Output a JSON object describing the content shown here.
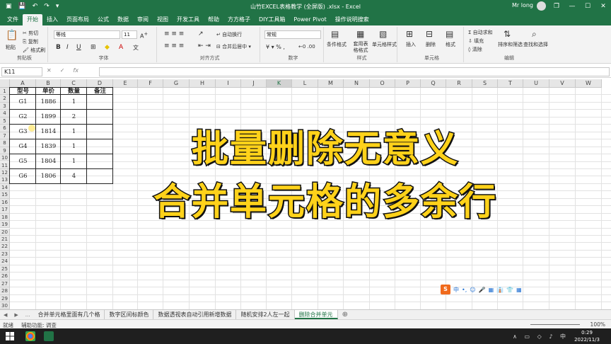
{
  "window": {
    "title": "山竹EXCEL表格教学 (全屏版) .xlsx - Excel",
    "user": "Mr long",
    "min": "—",
    "max": "☐",
    "close": "✕",
    "restore": "❐"
  },
  "ribbon_tabs": [
    "文件",
    "开始",
    "插入",
    "页面布局",
    "公式",
    "数据",
    "审阅",
    "视图",
    "开发工具",
    "帮助",
    "方方格子",
    "DIY工具箱",
    "Power Pivot",
    "操作说明搜索"
  ],
  "active_tab": "开始",
  "ribbon": {
    "clipboard": {
      "paste": "粘贴",
      "cut": "剪切",
      "copy": "复制",
      "painter": "格式刷",
      "label": "剪贴板"
    },
    "font": {
      "name": "等线",
      "size": "11",
      "bold": "B",
      "italic": "I",
      "underline": "U",
      "label": "字体"
    },
    "align": {
      "wrap": "自动换行",
      "merge": "合并后居中",
      "label": "对齐方式"
    },
    "number": {
      "format": "常规",
      "label": "数字"
    },
    "styles": {
      "cond": "条件格式",
      "table": "套用表格格式",
      "cell": "单元格样式",
      "label": "样式"
    },
    "cells": {
      "insert": "插入",
      "delete": "删除",
      "format": "格式",
      "label": "单元格"
    },
    "editing": {
      "autosum": "自动求和",
      "fill": "填充",
      "clear": "清除",
      "sort": "排序和筛选",
      "find": "查找和选择",
      "label": "编辑"
    }
  },
  "formula_bar": {
    "name_box": "K11",
    "fx": "fx",
    "value": ""
  },
  "columns": [
    "A",
    "B",
    "C",
    "D",
    "E",
    "F",
    "G",
    "H",
    "I",
    "J",
    "K",
    "L",
    "M",
    "N",
    "O",
    "P",
    "Q",
    "R",
    "S",
    "T",
    "U",
    "V",
    "W"
  ],
  "selected_column": "K",
  "rows": [
    "1",
    "2",
    "3",
    "4",
    "5",
    "6",
    "7",
    "8",
    "9",
    "10",
    "11",
    "12",
    "13",
    "14",
    "15",
    "16",
    "17",
    "18",
    "19",
    "20",
    "21",
    "22",
    "23",
    "24",
    "25",
    "26",
    "27",
    "28",
    "29",
    "30"
  ],
  "table": {
    "headers": [
      "型号",
      "单价",
      "数量",
      "备注"
    ],
    "records": [
      {
        "model": "G1",
        "price": "1886",
        "qty": "1"
      },
      {
        "model": "G2",
        "price": "1899",
        "qty": "2"
      },
      {
        "model": "G3",
        "price": "1814",
        "qty": "1"
      },
      {
        "model": "G4",
        "price": "1839",
        "qty": "1"
      },
      {
        "model": "G5",
        "price": "1804",
        "qty": "1"
      },
      {
        "model": "G6",
        "price": "1806",
        "qty": "4"
      }
    ]
  },
  "overlay": {
    "line1": "批量删除无意义",
    "line2": "合并单元格的多余行"
  },
  "ime": {
    "logo": "S",
    "items": [
      "中",
      "•,",
      "☺",
      "🎤",
      "▦",
      "👔",
      "👕",
      "▦"
    ]
  },
  "sheet_tabs": {
    "ellipsis": "...",
    "tabs": [
      "合并单元格里面有几个格",
      "数字区间标颜色",
      "数据透视表自动引用新增数据",
      "随机安排2人左一起",
      "删除合并单元"
    ],
    "active": "删除合并单元",
    "add": "⊕"
  },
  "status": {
    "ready": "就绪",
    "accessibility": "辅助功能: 调查",
    "zoom": "100%"
  },
  "taskbar": {
    "time": "0:29",
    "date": "2022/11/3"
  }
}
